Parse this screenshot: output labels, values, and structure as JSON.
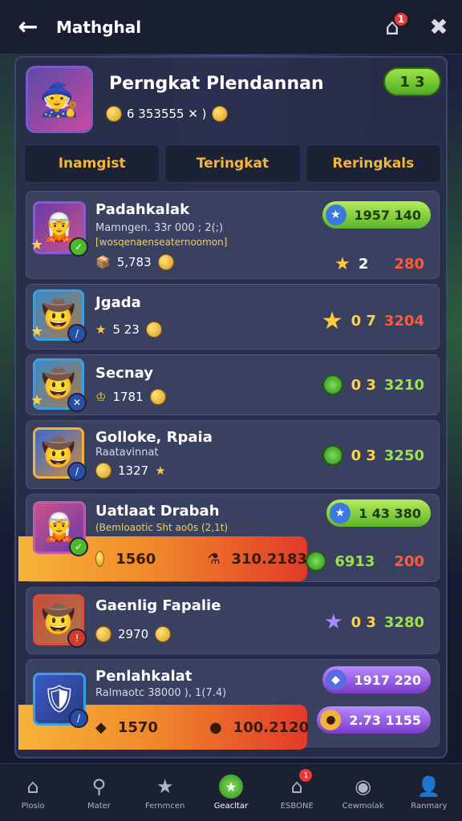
{
  "header": {
    "back_icon": "←",
    "title": "Mathghal",
    "home_badge": "1",
    "home_icon": "⌂",
    "close_icon": "✖"
  },
  "profile": {
    "title": "Perngkat Plendannan",
    "currency": "6 353555 ✕ )",
    "level": "1 3"
  },
  "tabs": [
    "Inamgist",
    "Teringkat",
    "Reringkals"
  ],
  "rows": [
    {
      "name": "Padahkalak",
      "sub1": "Mamngen. 33r 000 ; 2(;)",
      "sub2": "[wosqenaenseaternoomon]",
      "stat": "5,783",
      "pill": "1957 140",
      "stars": "2",
      "score": "280"
    },
    {
      "name": "Jgada",
      "stat": "5 23",
      "right_num1": "0 7",
      "right_num2": "3204"
    },
    {
      "name": "Secnay",
      "stat": "1781",
      "right_num1": "0 3",
      "right_num2": "3210"
    },
    {
      "name": "Golloke, Rpaia",
      "sub1": "Raatavinnat",
      "stat": "1327",
      "right_num1": "0 3",
      "right_num2": "3250"
    },
    {
      "name": "Uatlaat Drabah",
      "sub2": "(Bemloaotic Sht ao0s (2,1t)",
      "bar_a": "1560",
      "bar_b": "310.2183",
      "pill": "1 43 380",
      "right_num1": "6913",
      "right_num2": "200"
    },
    {
      "name": "Gaenlig Fapalie",
      "stat": "2970",
      "right_num1": "0 3",
      "right_num2": "3280"
    },
    {
      "name": "Penlahkalat",
      "sub1": "Ralmaotc 38000 ), 1(7.4)",
      "bar_a": "1570",
      "bar_b": "100.2120",
      "pill": "1917 220",
      "pill2": "2.73 1155"
    }
  ],
  "nav": [
    "Plosio",
    "Mater",
    "Fernmcen",
    "Geacltar",
    "ESBONE",
    "Cewmolak",
    "Ranmary"
  ],
  "nav_badge": "1"
}
